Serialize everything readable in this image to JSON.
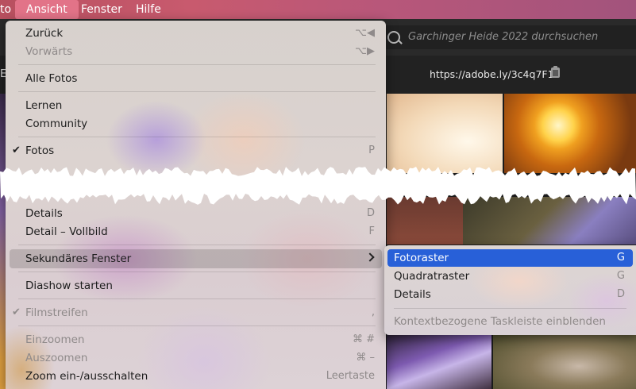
{
  "menubar": {
    "items": [
      {
        "label": "to"
      },
      {
        "label": "Ansicht",
        "active": true
      },
      {
        "label": "Fenster"
      },
      {
        "label": "Hilfe"
      }
    ],
    "accent": "#e27388"
  },
  "search": {
    "placeholder": "Garchinger Heide 2022 durchsuchen"
  },
  "urlbar": {
    "left_truncated": "EI",
    "url": "https://adobe.ly/3c4q7F1"
  },
  "menu": {
    "back": {
      "label": "Zurück",
      "shortcut": "⌥◀"
    },
    "forward": {
      "label": "Vorwärts",
      "shortcut": "⌥▶"
    },
    "all_photos": {
      "label": "Alle Fotos"
    },
    "learn": {
      "label": "Lernen"
    },
    "community": {
      "label": "Community"
    },
    "photos": {
      "label": "Fotos",
      "shortcut": "P",
      "checked": true
    },
    "details": {
      "label": "Details",
      "shortcut": "D"
    },
    "detail_full": {
      "label": "Detail – Vollbild",
      "shortcut": "F"
    },
    "secondary_window": {
      "label": "Sekundäres Fenster"
    },
    "slideshow": {
      "label": "Diashow starten"
    },
    "filmstrip": {
      "label": "Filmstreifen",
      "shortcut": ",",
      "checked": true
    },
    "zoom_in": {
      "label": "Einzoomen",
      "shortcut": "⌘ #"
    },
    "zoom_out": {
      "label": "Auszoomen",
      "shortcut": "⌘ –"
    },
    "zoom_toggle": {
      "label": "Zoom ein-/ausschalten",
      "shortcut": "Leertaste"
    },
    "check_glyph": "✔"
  },
  "submenu": {
    "items": [
      {
        "label": "Fotoraster",
        "shortcut": "G",
        "selected": true
      },
      {
        "label": "Quadratraster",
        "shortcut": "G"
      },
      {
        "label": "Details",
        "shortcut": "D"
      }
    ],
    "context_taskbar": {
      "label": "Kontextbezogene Taskleiste einblenden"
    },
    "selection_color": "#2860d8"
  }
}
